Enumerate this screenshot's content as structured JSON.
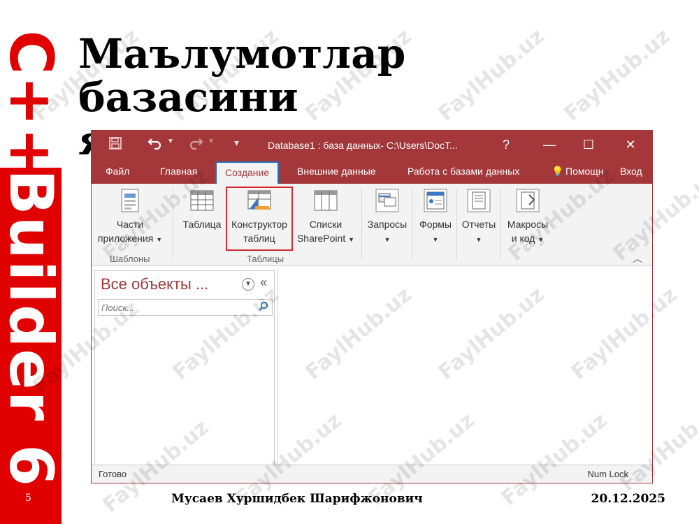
{
  "slide": {
    "side_top_text": "C++",
    "side_bottom_text": "Builder 6",
    "page_number": "5",
    "title_line1": "Маълумотлар базасини",
    "title_line2": "яратиш",
    "footer_author": "Мусаев Хуршидбек Шарифжонович",
    "footer_date": "20.12.2025",
    "watermark": "FaylHub.uz",
    "colors": {
      "banner": "#e00000",
      "access_accent": "#a4373a",
      "highlight": "#d62a2a"
    }
  },
  "window": {
    "title": "Database1 : база данных- C:\\Users\\DocT...",
    "help": "?",
    "controls": {
      "minimize": "—",
      "maximize": "☐",
      "close": "✕"
    },
    "qat": {
      "save_icon": "save-icon",
      "undo_icon": "undo-icon",
      "redo_icon": "redo-icon",
      "customize": "▾"
    },
    "tabs": [
      "Файл",
      "Главная",
      "Создание",
      "Внешние данные",
      "Работа с базами данных",
      "Помощн",
      "Вход"
    ],
    "active_tab": "Создание",
    "ribbon": {
      "parts_line1": "Части",
      "parts_line2": "приложения",
      "table": "Таблица",
      "designer_line1": "Конструктор",
      "designer_line2": "таблиц",
      "sharepoint_line1": "Списки",
      "sharepoint_line2": "SharePoint",
      "queries": "Запросы",
      "forms": "Формы",
      "reports": "Отчеты",
      "macros_line1": "Макросы",
      "macros_line2": "и код",
      "group_templates": "Шаблоны",
      "group_tables": "Таблицы"
    },
    "nav": {
      "header": "Все объекты ...",
      "search_placeholder": "Поиск..."
    },
    "status": {
      "left": "Готово",
      "right": "Num Lock"
    }
  }
}
